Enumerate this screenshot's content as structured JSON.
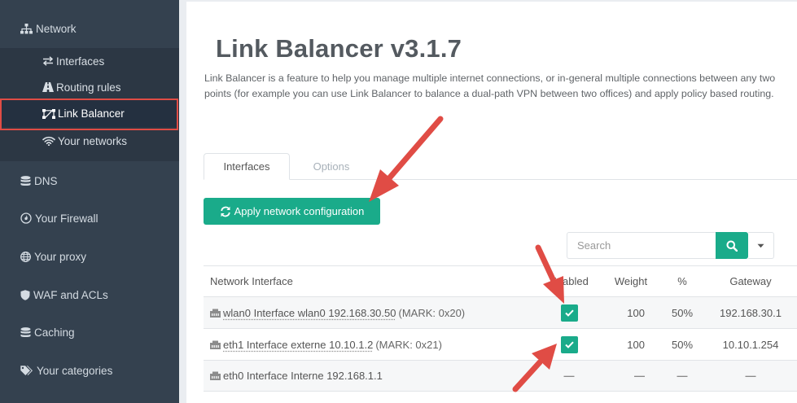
{
  "sidebar": {
    "items": [
      {
        "label": "Network",
        "icon": "sitemap-icon"
      },
      {
        "label": "DNS",
        "icon": "database-icon"
      },
      {
        "label": "Your Firewall",
        "icon": "firewall-icon"
      },
      {
        "label": "Your proxy",
        "icon": "globe-icon"
      },
      {
        "label": "WAF and ACLs",
        "icon": "shield-icon"
      },
      {
        "label": "Caching",
        "icon": "database-icon"
      },
      {
        "label": "Your categories",
        "icon": "tags-icon"
      }
    ],
    "network_sub": [
      {
        "label": "Interfaces",
        "icon": "exchange-icon"
      },
      {
        "label": "Routing rules",
        "icon": "road-icon"
      },
      {
        "label": "Link Balancer",
        "icon": "link-balancer-icon",
        "active": true
      },
      {
        "label": "Your networks",
        "icon": "wifi-icon"
      }
    ]
  },
  "page": {
    "title": "Link Balancer v3.1.7",
    "description": "Link Balancer is a feature to help you manage multiple internet connections, or in-general multiple connections between any two points (for example you can use Link Balancer to balance a dual-path VPN between two offices) and apply policy based routing."
  },
  "tabs": [
    {
      "label": "Interfaces",
      "active": true
    },
    {
      "label": "Options",
      "active": false
    }
  ],
  "apply_button": {
    "label": "Apply network configuration",
    "icon": "refresh-icon"
  },
  "search": {
    "placeholder": "Search",
    "icon": "search-icon",
    "dropdown_icon": "caret-down-icon"
  },
  "table": {
    "headers": {
      "interface": "Network Interface",
      "enabled": "Enabled",
      "weight": "Weight",
      "percent": "%",
      "gateway": "Gateway"
    },
    "rows": [
      {
        "name": "wlan0 Interface wlan0 192.168.30.50",
        "mark": "(MARK: 0x20)",
        "enabled": true,
        "weight": "100",
        "percent": "50%",
        "gateway": "192.168.30.1"
      },
      {
        "name": "eth1 Interface externe 10.10.1.2",
        "mark": "(MARK: 0x21)",
        "enabled": true,
        "weight": "100",
        "percent": "50%",
        "gateway": "10.10.1.254"
      },
      {
        "name": "eth0 Interface Interne 192.168.1.1",
        "mark": "",
        "enabled": false,
        "weight": "—",
        "percent": "—",
        "gateway": "—",
        "enabled_display": "—"
      }
    ]
  },
  "colors": {
    "sidebar_bg": "#34414f",
    "accent": "#1aab8a",
    "annotation_red": "#e04c45"
  }
}
